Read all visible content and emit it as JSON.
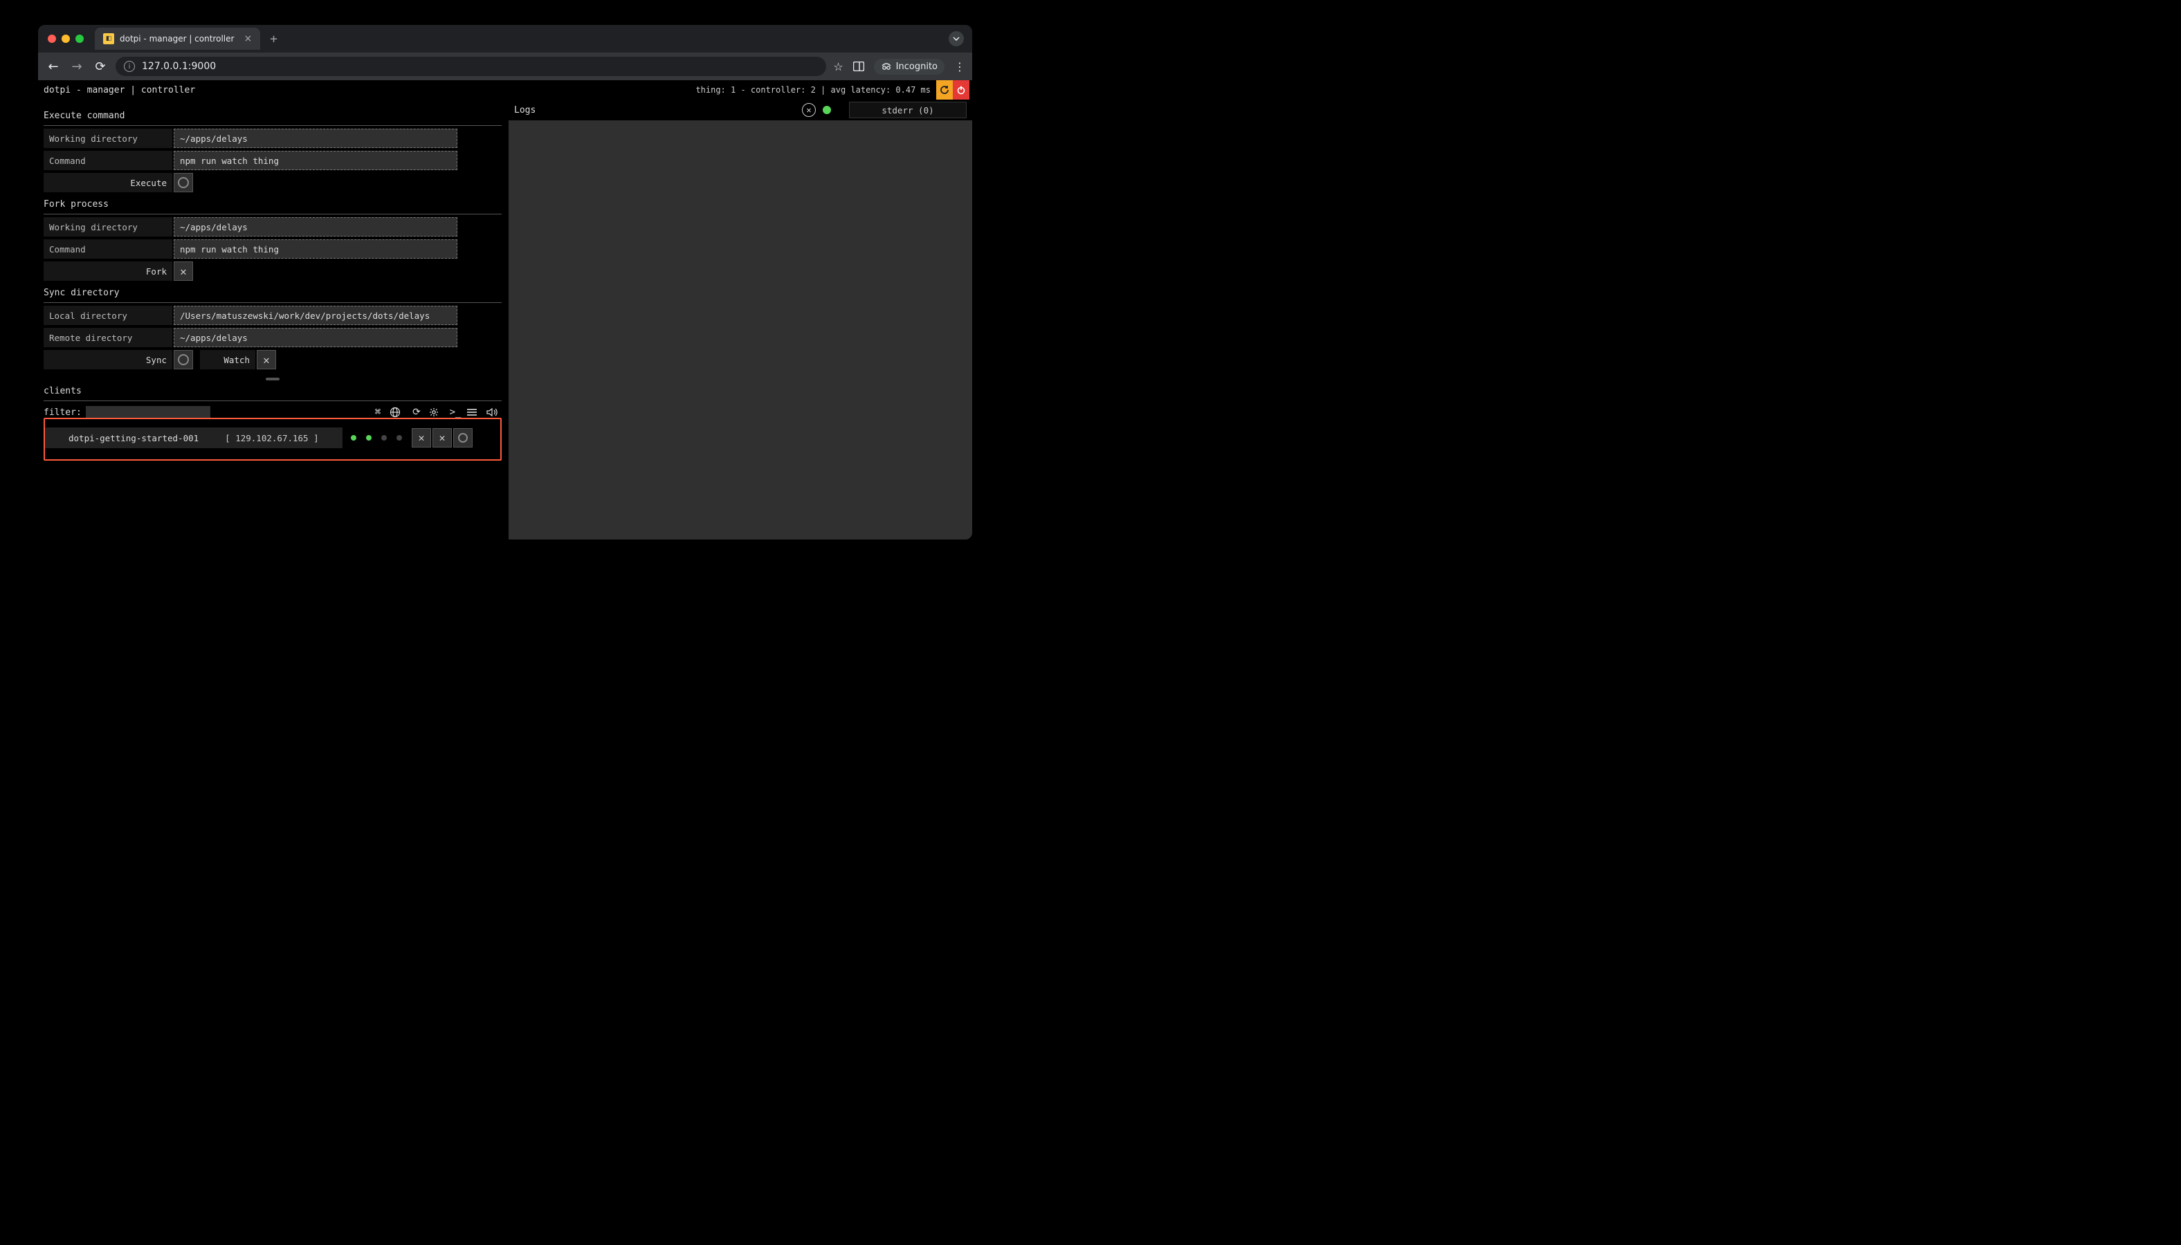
{
  "browser": {
    "tab_title": "dotpi - manager | controller",
    "url": "127.0.0.1:9000",
    "incognito_label": "Incognito"
  },
  "appbar": {
    "title": "dotpi - manager | controller",
    "status": "thing:  1 - controller:  2 | avg latency:  0.47 ms"
  },
  "exec": {
    "title": "Execute command",
    "wd_label": "Working directory",
    "wd_value": "~/apps/delays",
    "cmd_label": "Command",
    "cmd_value": "npm run watch thing",
    "btn_label": "Execute"
  },
  "fork": {
    "title": "Fork process",
    "wd_label": "Working directory",
    "wd_value": "~/apps/delays",
    "cmd_label": "Command",
    "cmd_value": "npm run watch thing",
    "btn_label": "Fork"
  },
  "sync": {
    "title": "Sync directory",
    "local_label": "Local directory",
    "local_value": "/Users/matuszewski/work/dev/projects/dots/delays",
    "remote_label": "Remote directory",
    "remote_value": "~/apps/delays",
    "sync_label": "Sync",
    "watch_label": "Watch"
  },
  "clients": {
    "title": "clients",
    "filter_label": "filter:",
    "row": {
      "name": "dotpi-getting-started-001",
      "ip": "[ 129.102.67.165 ]"
    }
  },
  "logs": {
    "title": "Logs",
    "stderr": "stderr (0)"
  }
}
